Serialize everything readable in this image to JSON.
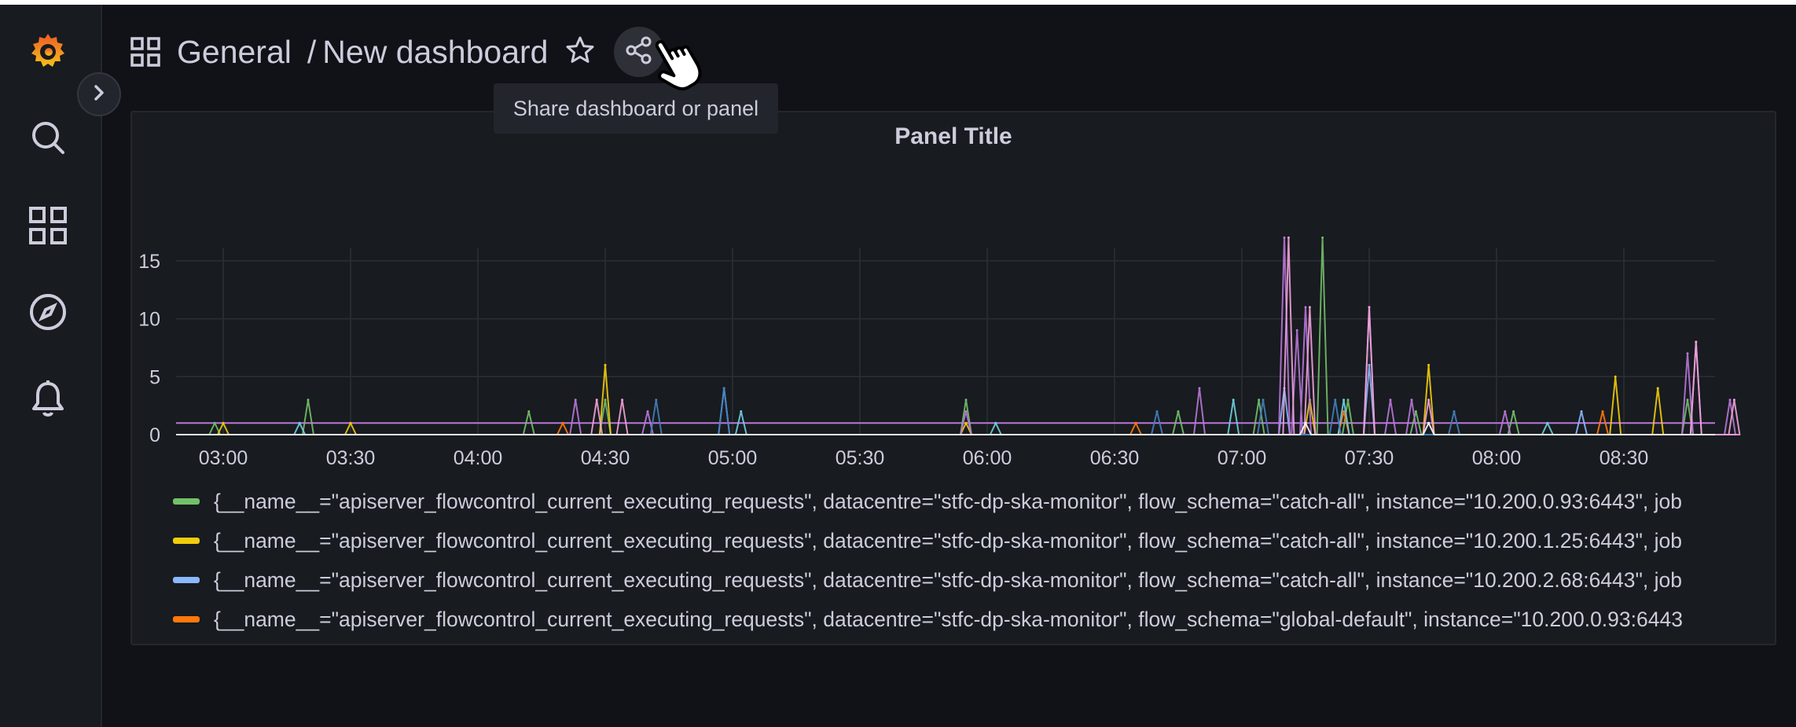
{
  "header": {
    "folder": "General",
    "separator": "/",
    "dashboard_title": "New dashboard"
  },
  "tooltip": {
    "text": "Share dashboard or panel"
  },
  "sidebar": {
    "items": [
      {
        "icon": "grafana-logo-icon"
      },
      {
        "icon": "search-icon"
      },
      {
        "icon": "dashboards-icon"
      },
      {
        "icon": "explore-icon"
      },
      {
        "icon": "alerting-bell-icon"
      }
    ],
    "expand_icon": "chevron-right-icon"
  },
  "panel": {
    "title": "Panel Title"
  },
  "colors": {
    "green": "#73bf69",
    "yellow": "#f2cc0c",
    "blue": "#8ab8ff",
    "orange": "#ff780a",
    "purple": "#b877d9",
    "pink": "#f2a2d8",
    "cyan": "#6ed0e0",
    "teal": "#447ebc",
    "dkgreen": "#508642",
    "white": "#ffffff"
  },
  "chart_data": {
    "type": "line",
    "title": "Panel Title",
    "x_ticks": [
      "03:00",
      "03:30",
      "04:00",
      "04:30",
      "05:00",
      "05:30",
      "06:00",
      "06:30",
      "07:00",
      "07:30",
      "08:00",
      "08:30"
    ],
    "y_ticks": [
      "0",
      "5",
      "10",
      "15"
    ],
    "ylim": [
      0,
      15
    ],
    "grid": true,
    "legend_placement": "bottom",
    "series": [
      {
        "name": "{__name__=\"apiserver_flowcontrol_current_executing_requests\", datacentre=\"stfc-dp-ska-monitor\", flow_schema=\"catch-all\", instance=\"10.200.0.93:6443\", job",
        "color": "#73bf69",
        "spikes": [
          [
            "02:58",
            1
          ],
          [
            "03:20",
            3
          ],
          [
            "04:12",
            2
          ],
          [
            "04:30",
            3
          ],
          [
            "05:55",
            3
          ],
          [
            "06:45",
            2
          ],
          [
            "07:04",
            3
          ],
          [
            "07:19",
            17
          ],
          [
            "07:25",
            3
          ],
          [
            "07:41",
            2
          ],
          [
            "08:04",
            2
          ],
          [
            "08:45",
            3
          ]
        ]
      },
      {
        "name": "{__name__=\"apiserver_flowcontrol_current_executing_requests\", datacentre=\"stfc-dp-ska-monitor\", flow_schema=\"catch-all\", instance=\"10.200.1.25:6443\", job",
        "color": "#f2cc0c",
        "spikes": [
          [
            "03:00",
            1
          ],
          [
            "03:30",
            1
          ],
          [
            "04:30",
            6
          ],
          [
            "05:55",
            1
          ],
          [
            "07:16",
            3
          ],
          [
            "07:44",
            6
          ],
          [
            "08:28",
            5
          ],
          [
            "08:38",
            4
          ]
        ]
      },
      {
        "name": "{__name__=\"apiserver_flowcontrol_current_executing_requests\", datacentre=\"stfc-dp-ska-monitor\", flow_schema=\"catch-all\", instance=\"10.200.2.68:6443\", job",
        "color": "#8ab8ff",
        "spikes": [
          [
            "04:58",
            4
          ],
          [
            "07:10",
            4
          ],
          [
            "07:30",
            6
          ],
          [
            "08:20",
            2
          ]
        ]
      },
      {
        "name": "{__name__=\"apiserver_flowcontrol_current_executing_requests\", datacentre=\"stfc-dp-ska-monitor\", flow_schema=\"global-default\", instance=\"10.200.0.93:6443",
        "color": "#ff780a",
        "spikes": [
          [
            "04:20",
            1
          ],
          [
            "06:35",
            1
          ],
          [
            "07:24",
            2
          ],
          [
            "08:25",
            2
          ]
        ]
      },
      {
        "color": "#b877d9",
        "spikes": [
          [
            "04:23",
            3
          ],
          [
            "04:40",
            2
          ],
          [
            "05:55",
            2
          ],
          [
            "06:50",
            4
          ],
          [
            "07:10",
            17
          ],
          [
            "07:13",
            9
          ],
          [
            "07:15",
            11
          ],
          [
            "07:30",
            11
          ],
          [
            "07:35",
            3
          ],
          [
            "07:40",
            3
          ],
          [
            "08:02",
            2
          ],
          [
            "08:45",
            7
          ],
          [
            "08:47",
            8
          ],
          [
            "08:55",
            3
          ]
        ]
      },
      {
        "color": "#f2a2d8",
        "spikes": [
          [
            "04:34",
            3
          ],
          [
            "04:28",
            3
          ],
          [
            "07:11",
            17
          ],
          [
            "07:16",
            11
          ],
          [
            "07:30",
            11
          ],
          [
            "07:44",
            3
          ],
          [
            "08:47",
            8
          ],
          [
            "08:56",
            3
          ]
        ]
      },
      {
        "color": "#6ed0e0",
        "spikes": [
          [
            "03:18",
            1
          ],
          [
            "05:02",
            2
          ],
          [
            "06:02",
            1
          ],
          [
            "06:58",
            3
          ],
          [
            "07:24",
            3
          ],
          [
            "08:12",
            1
          ]
        ]
      },
      {
        "color": "#447ebc",
        "spikes": [
          [
            "04:42",
            3
          ],
          [
            "04:58",
            4
          ],
          [
            "06:40",
            2
          ],
          [
            "07:05",
            3
          ],
          [
            "07:22",
            3
          ],
          [
            "07:50",
            2
          ]
        ]
      },
      {
        "color": "#ffffff",
        "spikes": [
          [
            "07:15",
            1
          ],
          [
            "07:44",
            1
          ]
        ]
      }
    ]
  }
}
